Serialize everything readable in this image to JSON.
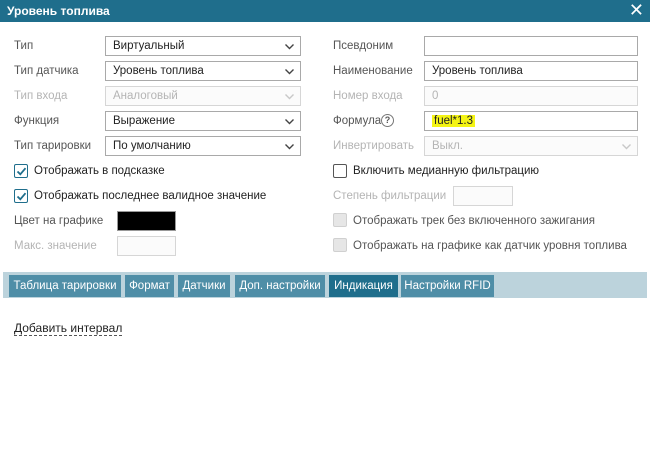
{
  "window": {
    "title": "Уровень топлива"
  },
  "left": {
    "type": {
      "label": "Тип",
      "value": "Виртуальный"
    },
    "sensor_type": {
      "label": "Тип датчика",
      "value": "Уровень топлива"
    },
    "input_type": {
      "label": "Тип входа",
      "value": "Аналоговый"
    },
    "function": {
      "label": "Функция",
      "value": "Выражение"
    },
    "calibration_type": {
      "label": "Тип тарировки",
      "value": "По умолчанию"
    },
    "show_in_tooltip": {
      "label": "Отображать в подсказке",
      "checked": true
    },
    "show_last_valid": {
      "label": "Отображать последнее валидное значение",
      "checked": true
    },
    "chart_color": {
      "label": "Цвет на графике",
      "color": "#000000"
    },
    "max_value": {
      "label": "Макс. значение",
      "value": ""
    }
  },
  "right": {
    "alias": {
      "label": "Псевдоним",
      "value": ""
    },
    "name": {
      "label": "Наименование",
      "value": "Уровень топлива"
    },
    "input_number": {
      "label": "Номер входа",
      "value": "0"
    },
    "formula": {
      "label": "Формула",
      "value": "fuel*1.3"
    },
    "invert": {
      "label": "Инвертировать",
      "value": "Выкл."
    },
    "median_filter": {
      "label": "Включить медианную фильтрацию",
      "checked": false
    },
    "filter_degree": {
      "label": "Степень фильтрации",
      "value": ""
    },
    "show_track_no_ignition": {
      "label": "Отображать трек без включенного зажигания",
      "checked": false
    },
    "show_as_fuel_sensor": {
      "label": "Отображать на графике как датчик уровня топлива",
      "checked": false
    }
  },
  "tabs": [
    {
      "label": "Таблица тарировки",
      "active": false
    },
    {
      "label": "Формат",
      "active": false
    },
    {
      "label": "Датчики",
      "active": false
    },
    {
      "label": "Доп. настройки",
      "active": false
    },
    {
      "label": "Индикация",
      "active": true
    },
    {
      "label": "Настройки RFID",
      "active": false
    }
  ],
  "indication": {
    "add_interval_label": "Добавить интервал"
  },
  "colors": {
    "titlebar": "#1f6e8c",
    "tab": "#4f8ea7",
    "tab_active": "#1f6e8c",
    "formula_highlight": "#f4f414"
  }
}
